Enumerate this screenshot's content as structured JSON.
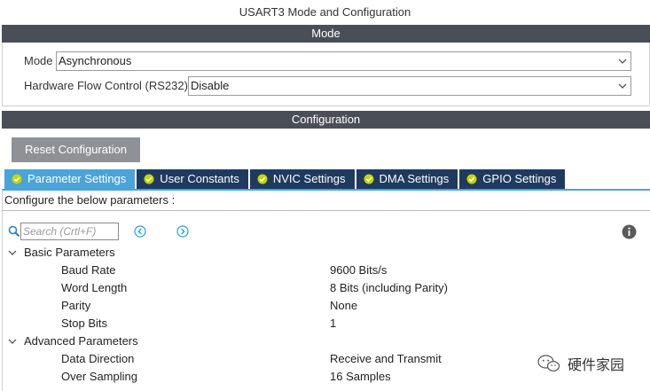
{
  "window": {
    "title": "USART3 Mode and Configuration"
  },
  "mode_section": {
    "header": "Mode",
    "mode_label": "Mode",
    "mode_value": "Asynchronous",
    "flow_label": "Hardware Flow Control (RS232)",
    "flow_value": "Disable"
  },
  "config_section": {
    "header": "Configuration",
    "reset_button": "Reset Configuration"
  },
  "tabs": [
    {
      "label": "Parameter Settings",
      "active": true
    },
    {
      "label": "User Constants",
      "active": false
    },
    {
      "label": "NVIC Settings",
      "active": false
    },
    {
      "label": "DMA Settings",
      "active": false
    },
    {
      "label": "GPIO Settings",
      "active": false
    }
  ],
  "panel": {
    "instructions": "Configure the below parameters :",
    "search_placeholder": "Search (Crtl+F)"
  },
  "groups": [
    {
      "label": "Basic Parameters",
      "params": [
        {
          "name": "Baud Rate",
          "value": "9600 Bits/s"
        },
        {
          "name": "Word Length",
          "value": "8 Bits (including Parity)"
        },
        {
          "name": "Parity",
          "value": "None"
        },
        {
          "name": "Stop Bits",
          "value": "1"
        }
      ]
    },
    {
      "label": "Advanced Parameters",
      "params": [
        {
          "name": "Data Direction",
          "value": "Receive and Transmit"
        },
        {
          "name": "Over Sampling",
          "value": "16 Samples"
        }
      ]
    }
  ],
  "watermark": {
    "text": "硬件家园"
  },
  "colors": {
    "section_bar": "#4a4f57",
    "tab_inactive": "#1f3a5f",
    "tab_active": "#4aa3d9",
    "check_fill": "#c8d400",
    "reset_button": "#8e9297"
  }
}
